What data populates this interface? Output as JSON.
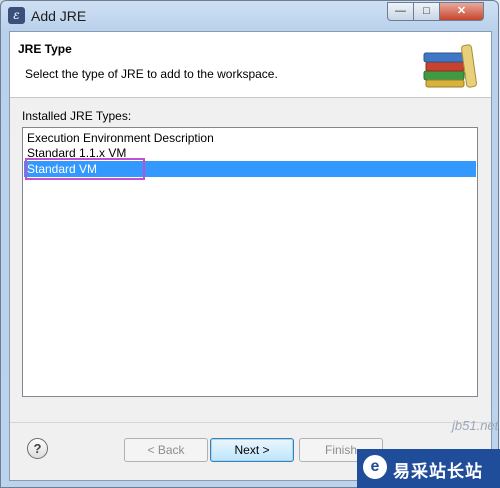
{
  "window": {
    "title": "Add JRE",
    "app_icon": "eclipse-icon",
    "controls": {
      "minimize": "—",
      "maximize": "□",
      "close": "✕"
    }
  },
  "header": {
    "title": "JRE Type",
    "description": "Select the type of JRE to add to the workspace.",
    "icon": "books-icon"
  },
  "installed_types": {
    "label": "Installed JRE Types:",
    "items": [
      {
        "label": "Execution Environment Description",
        "selected": false
      },
      {
        "label": "Standard 1.1.x VM",
        "selected": false
      },
      {
        "label": "Standard VM",
        "selected": true
      }
    ]
  },
  "footer": {
    "help": "?",
    "back": "< Back",
    "next": "Next >",
    "finish": "Finish"
  },
  "watermark": {
    "logo": "e",
    "text": "易采站长站",
    "faint": "jb51.net"
  },
  "colors": {
    "selection": "#3399ff",
    "annotation": "#c050d0",
    "watermark_bg": "#1f4d9a"
  }
}
